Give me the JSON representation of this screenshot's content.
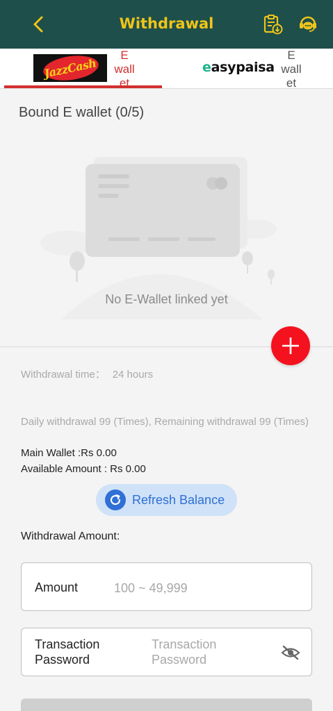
{
  "header": {
    "title": "Withdrawal",
    "back_icon": "chevron-left-icon",
    "records_icon": "clipboard-download-icon",
    "support_icon": "customer-service-icon",
    "background": "#1e4f4a",
    "accent": "#f0c419"
  },
  "tabs": [
    {
      "logo": "JazzCash",
      "label": "E wall et",
      "active": true
    },
    {
      "logo": "easypaisa",
      "label": "E wall et",
      "active": false
    }
  ],
  "wallets": {
    "bound_title": "Bound E wallet (0/5)",
    "empty_text": "No E-Wallet linked yet",
    "add_icon": "plus-icon"
  },
  "info": {
    "withdrawal_time_label": "Withdrawal time：",
    "withdrawal_time_value": "24 hours",
    "daily_limit": "Daily withdrawal 99 (Times), Remaining withdrawal 99 (Times)",
    "main_wallet": "Main Wallet :Rs 0.00",
    "available_amount": "Available Amount : Rs 0.00"
  },
  "refresh": {
    "label": "Refresh Balance",
    "icon": "refresh-icon"
  },
  "form": {
    "withdrawal_amount_label": "Withdrawal Amount:",
    "amount_label": "Amount",
    "amount_placeholder": "100 ~ 49,999",
    "password_label": "Transaction Password",
    "password_placeholder": "Transaction Password",
    "eye_icon": "eye-off-icon"
  },
  "colors": {
    "danger": "#f4121f",
    "active_tab": "#d32f2f",
    "refresh": "#2f6fd6"
  }
}
